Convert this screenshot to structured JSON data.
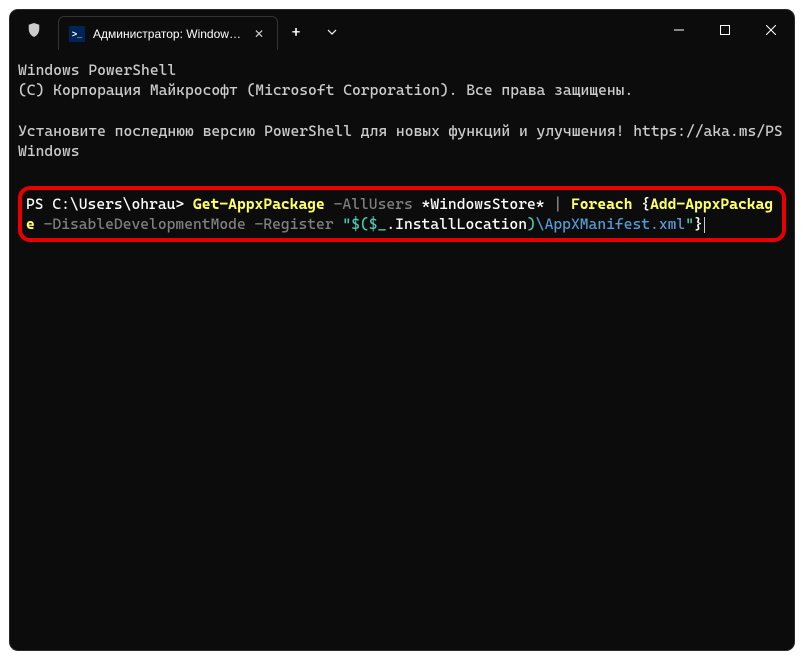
{
  "titlebar": {
    "tab_label": "Администратор: Windows Pc"
  },
  "terminal": {
    "line1": "Windows PowerShell",
    "line2": "(C) Корпорация Майкрософт (Microsoft Corporation). Все права защищены.",
    "line3": "Установите последнюю версию PowerShell для новых функций и улучшения! https://aka.ms/PSWindows",
    "prompt": "PS C:\\Users\\ohrau> ",
    "cmd": {
      "get": "Get-AppxPackage",
      "allusers": " -AllUsers ",
      "filter": "*WindowsStore*",
      "pipe": " | ",
      "foreach": "Foreach",
      "brace_open": " {",
      "add": "Add-AppxPackage",
      "disable": " -DisableDevelopmentMode -Register ",
      "quote1": "\"$(",
      "var": "$_",
      "install": ".InstallLocation",
      "close_paren": ")",
      "manifest": "\\AppXManifest.xml",
      "quote2": "\"",
      "brace_close": "}"
    }
  }
}
